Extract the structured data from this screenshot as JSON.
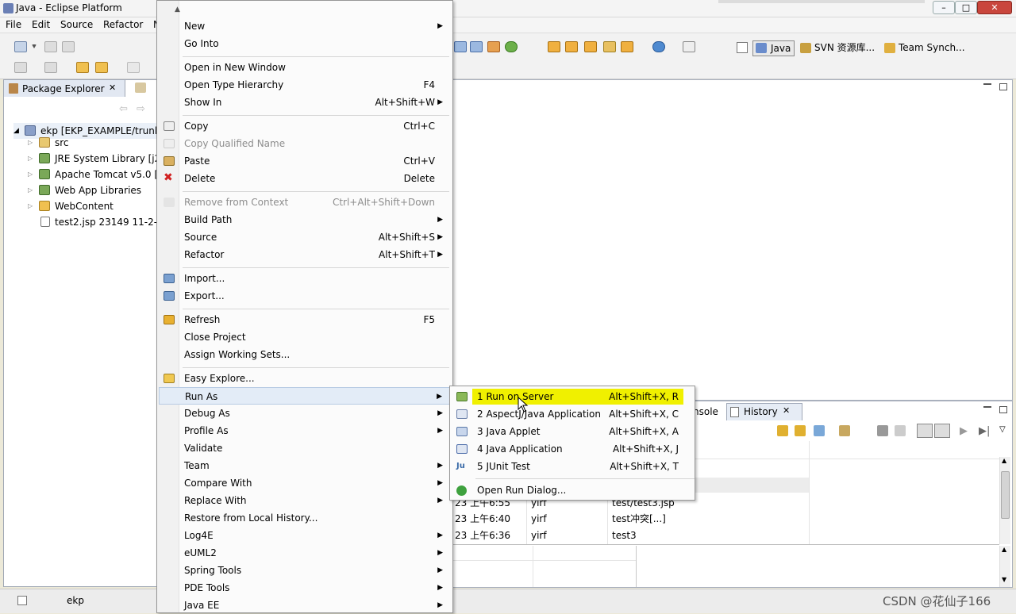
{
  "window": {
    "title": "Java - Eclipse Platform",
    "minimize": "–",
    "maximize": "□",
    "close": "✕"
  },
  "menubar": [
    "File",
    "Edit",
    "Source",
    "Refactor",
    "N"
  ],
  "perspectives": [
    "Java",
    "SVN 资源库...",
    "Team Synch..."
  ],
  "package_explorer": {
    "tab_label": "Package Explorer",
    "tree": [
      {
        "label": "ekp [EKP_EXAMPLE/trunk",
        "icon": "project-icon"
      },
      {
        "label": "src",
        "icon": "package-folder-icon"
      },
      {
        "label": "JRE System Library [j2",
        "icon": "library-icon"
      },
      {
        "label": "Apache Tomcat v5.0 [A",
        "icon": "library-icon"
      },
      {
        "label": "Web App Libraries",
        "icon": "library-icon"
      },
      {
        "label": "WebContent",
        "icon": "folder-icon"
      },
      {
        "label": "test2.jsp 23149  11-2-",
        "icon": "file-icon"
      }
    ]
  },
  "context_menu": {
    "items": [
      {
        "label": "New",
        "shortcut": "",
        "submenu": true
      },
      {
        "label": "Go Into",
        "shortcut": ""
      },
      {
        "label": "Open in New Window",
        "shortcut": ""
      },
      {
        "label": "Open Type Hierarchy",
        "shortcut": "F4"
      },
      {
        "label": "Show In",
        "shortcut": "Alt+Shift+W",
        "submenu": true
      },
      {
        "label": "Copy",
        "shortcut": "Ctrl+C"
      },
      {
        "label": "Copy Qualified Name",
        "shortcut": ""
      },
      {
        "label": "Paste",
        "shortcut": "Ctrl+V"
      },
      {
        "label": "Delete",
        "shortcut": "Delete"
      },
      {
        "label": "Remove from Context",
        "shortcut": "Ctrl+Alt+Shift+Down"
      },
      {
        "label": "Build Path",
        "shortcut": "",
        "submenu": true
      },
      {
        "label": "Source",
        "shortcut": "Alt+Shift+S",
        "submenu": true
      },
      {
        "label": "Refactor",
        "shortcut": "Alt+Shift+T",
        "submenu": true
      },
      {
        "label": "Import...",
        "shortcut": ""
      },
      {
        "label": "Export...",
        "shortcut": ""
      },
      {
        "label": "Refresh",
        "shortcut": "F5"
      },
      {
        "label": "Close Project",
        "shortcut": ""
      },
      {
        "label": "Assign Working Sets...",
        "shortcut": ""
      },
      {
        "label": "Easy Explore...",
        "shortcut": ""
      },
      {
        "label": "Run As",
        "shortcut": "",
        "submenu": true
      },
      {
        "label": "Debug As",
        "shortcut": "",
        "submenu": true
      },
      {
        "label": "Profile As",
        "shortcut": "",
        "submenu": true
      },
      {
        "label": "Validate",
        "shortcut": ""
      },
      {
        "label": "Team",
        "shortcut": "",
        "submenu": true
      },
      {
        "label": "Compare With",
        "shortcut": "",
        "submenu": true
      },
      {
        "label": "Replace With",
        "shortcut": "",
        "submenu": true
      },
      {
        "label": "Restore from Local History...",
        "shortcut": ""
      },
      {
        "label": "Log4E",
        "shortcut": "",
        "submenu": true
      },
      {
        "label": "eUML2",
        "shortcut": "",
        "submenu": true
      },
      {
        "label": "Spring Tools",
        "shortcut": "",
        "submenu": true
      },
      {
        "label": "PDE Tools",
        "shortcut": "",
        "submenu": true
      },
      {
        "label": "Java EE",
        "shortcut": "",
        "submenu": true
      }
    ]
  },
  "run_as_submenu": {
    "items": [
      {
        "label": "1 Run on Server",
        "shortcut": "Alt+Shift+X, R"
      },
      {
        "label": "2 AspectJ/Java Application",
        "shortcut": "Alt+Shift+X, C"
      },
      {
        "label": "3 Java Applet",
        "shortcut": "Alt+Shift+X, A"
      },
      {
        "label": "4 Java Application",
        "shortcut": "Alt+Shift+X, J"
      },
      {
        "label": "5 JUnit Test",
        "shortcut": "Alt+Shift+X, T"
      },
      {
        "label": "Open Run Dialog...",
        "shortcut": ""
      }
    ]
  },
  "bottom_panel": {
    "console_tab": "nsole",
    "history_tab": "History",
    "rows": [
      {
        "time": "23 上午6:55",
        "author": "yirf",
        "comment": "test/test3.jsp"
      },
      {
        "time": "23 上午6:40",
        "author": "yirf",
        "comment": "test冲突[...]"
      },
      {
        "time": "23 上午6:36",
        "author": "yirf",
        "comment": "test3"
      }
    ]
  },
  "statusbar": {
    "project": "ekp",
    "watermark": "CSDN @花仙子166"
  },
  "colors": {
    "highlight": "#f0f000",
    "menu_hover": "#e3ecf7",
    "accent": "#316ac5"
  }
}
